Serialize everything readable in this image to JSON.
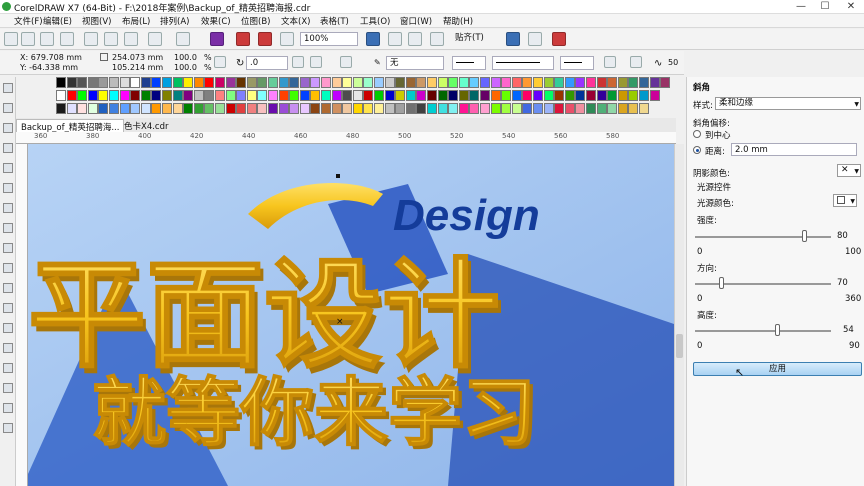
{
  "window": {
    "title": "CorelDRAW X7 (64-Bit) - F:\\2018年案例\\Backup_of_精英招聘海报.cdr",
    "min": "—",
    "max": "☐",
    "close": "✕"
  },
  "menu": [
    "文件(F)",
    "编辑(E)",
    "视图(V)",
    "布局(L)",
    "排列(A)",
    "效果(C)",
    "位图(B)",
    "文本(X)",
    "表格(T)",
    "工具(O)",
    "窗口(W)",
    "帮助(H)"
  ],
  "toolbar": {
    "zoom": "100%",
    "snap": "贴齐(T)"
  },
  "properties": {
    "x": "X: 679.708 mm",
    "y": "Y: -64.338 mm",
    "w": "254.073 mm",
    "h": "105.214 mm",
    "sx": "100.0",
    "sy": "100.0",
    "pct": "%",
    "angle": ".0",
    "outline": "无",
    "size": "50"
  },
  "palette_colors_row1": [
    "#000000",
    "#333333",
    "#555555",
    "#777777",
    "#999999",
    "#bbbbbb",
    "#dddddd",
    "#ffffff",
    "#1f3f8f",
    "#0040ff",
    "#00a0e0",
    "#00c060",
    "#ffee00",
    "#ff8800",
    "#ff0000",
    "#cc0066",
    "#993399",
    "#663300",
    "#999966",
    "#669966",
    "#66cc99",
    "#3399cc",
    "#336699",
    "#9966cc",
    "#cc99ff",
    "#ff99cc",
    "#ffcc99",
    "#ffff99",
    "#ccff99",
    "#99ffcc",
    "#99ccff",
    "#cccccc",
    "#666633",
    "#996633",
    "#cc9966",
    "#ffcc66",
    "#ccff66",
    "#66ff66",
    "#66ffcc",
    "#66ccff",
    "#6666ff",
    "#cc66ff",
    "#ff66cc",
    "#ff6666",
    "#ff9933",
    "#ffcc33",
    "#99cc33",
    "#33cc99",
    "#3399ff",
    "#9933ff",
    "#ff3399",
    "#cc3333",
    "#cc6633",
    "#999933",
    "#339966",
    "#336699",
    "#663399",
    "#993366"
  ],
  "palette_colors_row2": [
    "#ffffff",
    "#ff0000",
    "#00ff00",
    "#0000ff",
    "#ffff00",
    "#00ffff",
    "#ff00ff",
    "#800000",
    "#008000",
    "#000080",
    "#808000",
    "#008080",
    "#800080",
    "#c0c0c0",
    "#808080",
    "#ff8080",
    "#80ff80",
    "#8080ff",
    "#ffff80",
    "#80ffff",
    "#ff80ff",
    "#ff4000",
    "#40ff00",
    "#0040ff",
    "#ffbf00",
    "#00ffbf",
    "#bf00ff",
    "#4d4d4d",
    "#e6e6e6",
    "#cc0000",
    "#00cc00",
    "#0000cc",
    "#cccc00",
    "#00cccc",
    "#cc00cc",
    "#660000",
    "#006600",
    "#000066",
    "#666600",
    "#006666",
    "#660066",
    "#ff6600",
    "#66ff00",
    "#0066ff",
    "#ff0066",
    "#6600ff",
    "#00ff66",
    "#993300",
    "#339900",
    "#003399",
    "#990033",
    "#330099",
    "#009933",
    "#cc9900",
    "#99cc00",
    "#0099cc",
    "#cc0099"
  ],
  "palette_colors_row3": [
    "#1a1a1a",
    "#e0e0ff",
    "#ffe0e0",
    "#e0ffe0",
    "#2060c0",
    "#4080e0",
    "#60a0ff",
    "#a0c8ff",
    "#d0e4ff",
    "#ff9900",
    "#ffb84d",
    "#ffd699",
    "#008000",
    "#33a033",
    "#66c066",
    "#99e099",
    "#cc0000",
    "#e04040",
    "#f08080",
    "#f8c0c0",
    "#6a0dad",
    "#9a4dd6",
    "#c890f0",
    "#e8c8ff",
    "#8b4513",
    "#b06a30",
    "#d09060",
    "#f0c8a0",
    "#ffd700",
    "#ffe44d",
    "#fff099",
    "#c0c0c0",
    "#a0a0a0",
    "#707070",
    "#404040",
    "#00ced1",
    "#40e0e0",
    "#80f0f0",
    "#ff1493",
    "#ff60b0",
    "#ffa0d0",
    "#7cfc00",
    "#a0ff40",
    "#c8ff90",
    "#4169e1",
    "#6a8ef0",
    "#9cb4f8",
    "#dc143c",
    "#e8506a",
    "#f090a0",
    "#2e8b57",
    "#50b078",
    "#90d8a8",
    "#daa520",
    "#e8c050",
    "#f0d890"
  ],
  "document_tabs": [
    "Backup_of_精英招聘海...",
    "色卡X4.cdr"
  ],
  "ruler_marks": [
    "360",
    "380",
    "400",
    "420",
    "440",
    "460",
    "480",
    "500",
    "520",
    "540",
    "560",
    "580"
  ],
  "artwork": {
    "word": "Design",
    "headline": "平面设计",
    "subline": "就等你来学习"
  },
  "panel": {
    "title": "斜角",
    "style_label": "样式:",
    "style_value": "柔和边缘",
    "offset_label": "斜角偏移:",
    "to_center": "到中心",
    "distance_label": "距离:",
    "distance_value": "2.0 mm",
    "shadow_color_label": "阴影颜色:",
    "light_control_label": "光源控件",
    "light_color_label": "光源颜色:",
    "intensity_label": "强度:",
    "intensity_min": "0",
    "intensity_max": "100",
    "intensity_value": "80",
    "direction_label": "方向:",
    "direction_min": "0",
    "direction_max": "360",
    "direction_value": "70",
    "altitude_label": "高度:",
    "altitude_min": "0",
    "altitude_max": "90",
    "altitude_value": "54",
    "apply": "应用"
  },
  "colors": {
    "accent": "#3c7fb1",
    "gold": "#f7c51e",
    "navy": "#143c9a",
    "bg": "#a9c8f2"
  }
}
